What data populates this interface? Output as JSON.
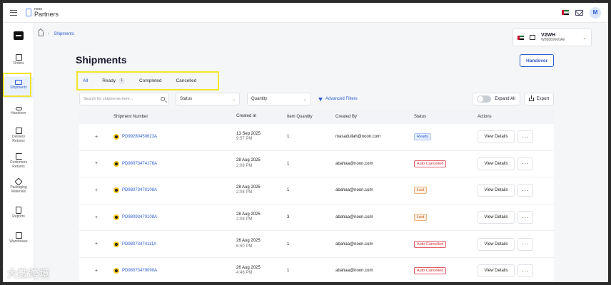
{
  "colors": {
    "accent": "#2d5bd0",
    "highlight": "#f0e62d",
    "danger": "#d8343a",
    "warning": "#c25b12"
  },
  "topbar": {
    "brand_small": "noon",
    "brand_big": "Partners",
    "avatar_initial": "M"
  },
  "sidebar": {
    "items": [
      {
        "label": "Orders",
        "icon": "orders-icon"
      },
      {
        "label": "Shipments",
        "icon": "truck-icon"
      },
      {
        "label": "Handover",
        "icon": "handover-icon"
      },
      {
        "label": "Delivery Returns",
        "icon": "delivery-returns-icon"
      },
      {
        "label": "Customers Returns",
        "icon": "customer-returns-icon"
      },
      {
        "label": "Packaging Materials",
        "icon": "package-icon"
      },
      {
        "label": "Reports",
        "icon": "report-icon"
      },
      {
        "label": "Warehouse",
        "icon": "warehouse-icon"
      }
    ]
  },
  "breadcrumb": {
    "current": "Shipments"
  },
  "warehouse": {
    "code": "V2WH",
    "id": "W88889660AE"
  },
  "page": {
    "title": "Shipments",
    "handover_label": "Handover"
  },
  "tabs": [
    {
      "label": "All"
    },
    {
      "label": "Ready",
      "count": "1"
    },
    {
      "label": "Completed"
    },
    {
      "label": "Cancelled"
    }
  ],
  "filters": {
    "search_placeholder": "Search for shipments here...",
    "status_label": "Status",
    "quantity_label": "Quantity",
    "advanced_label": "Advanced Filters",
    "expand_label": "Expand All",
    "export_label": "Export"
  },
  "table": {
    "headers": {
      "number": "Shipment Number",
      "created": "Created at",
      "qty": "Item Quantity",
      "by": "Created By",
      "status": "Status",
      "actions": "Actions"
    },
    "view_label": "View Details",
    "more_label": "···",
    "expand_symbol": "+",
    "rows": [
      {
        "number": "PD99280450623A",
        "date": "13 Sep 2025",
        "time": "9:57 PM",
        "qty": "1",
        "by": "masadullah@noon.com",
        "status": "Ready",
        "kind": "ready"
      },
      {
        "number": "PD98073474176A",
        "date": "28 Aug 2025",
        "time": "2:08 PM",
        "qty": "1",
        "by": "abahaa@noon.com",
        "status": "Auto Cancelled",
        "kind": "cancelled"
      },
      {
        "number": "PD98073470108A",
        "date": "28 Aug 2025",
        "time": "2:08 PM",
        "qty": "1",
        "by": "abahaa@noon.com",
        "status": "Lost",
        "kind": "lost"
      },
      {
        "number": "PD98093470108A",
        "date": "28 Aug 2025",
        "time": "2:08 PM",
        "qty": "3",
        "by": "abahaa@noon.com",
        "status": "Lost",
        "kind": "lost"
      },
      {
        "number": "PD98073474111A",
        "date": "26 Aug 2025",
        "time": "6:50 PM",
        "qty": "1",
        "by": "abahaa@noon.com",
        "status": "Auto Cancelled",
        "kind": "cancelled"
      },
      {
        "number": "PD98073479090A",
        "date": "26 Aug 2025",
        "time": "4:46 PM",
        "qty": "1",
        "by": "abahaa@noon.com",
        "status": "Auto Cancelled",
        "kind": "cancelled"
      }
    ]
  },
  "watermark": "大數跨境"
}
